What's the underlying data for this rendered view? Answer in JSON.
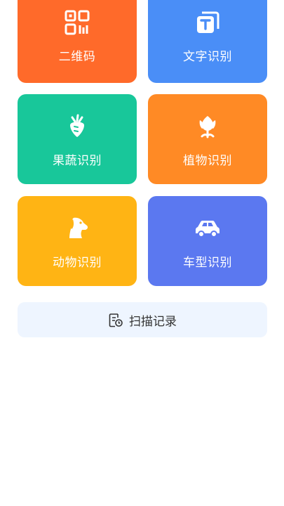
{
  "tiles": [
    {
      "label": "二维码",
      "icon": "qr-code-icon",
      "color": "#FF6A2A"
    },
    {
      "label": "文字识别",
      "icon": "text-t-icon",
      "color": "#4A8EF7"
    },
    {
      "label": "果蔬识别",
      "icon": "carrot-icon",
      "color": "#18C79A"
    },
    {
      "label": "植物识别",
      "icon": "tulip-icon",
      "color": "#FF8A25"
    },
    {
      "label": "动物识别",
      "icon": "dog-icon",
      "color": "#FFB414"
    },
    {
      "label": "车型识别",
      "icon": "car-icon",
      "color": "#5B78F0"
    }
  ],
  "history": {
    "label": "扫描记录",
    "icon": "history-doc-icon",
    "bg": "#EEF5FF"
  }
}
